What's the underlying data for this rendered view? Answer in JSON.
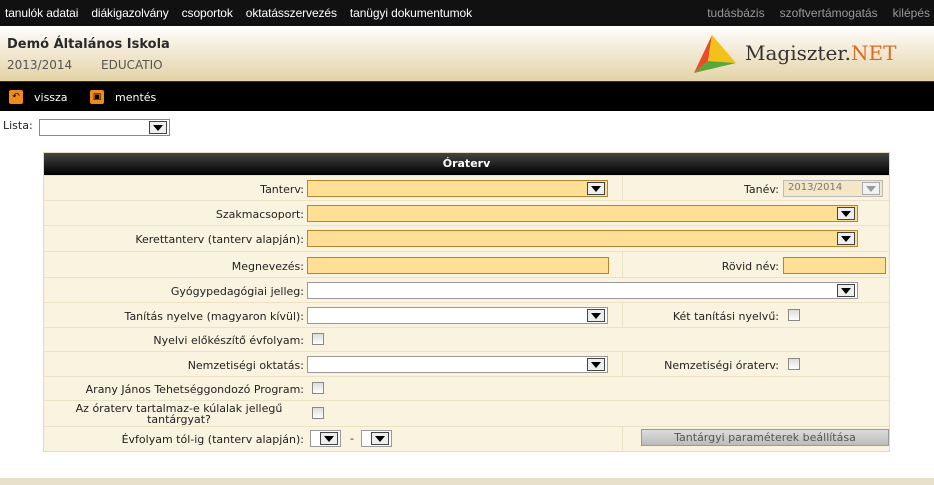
{
  "topnav": {
    "items": [
      "tanulók adatai",
      "diákigazolvány",
      "csoportok",
      "oktatásszervezés",
      "tanügyi dokumentumok"
    ],
    "right_items": [
      "tudásbázis",
      "szoftvertámogatás",
      "kilépés"
    ]
  },
  "header": {
    "school": "Demó Általános Iskola",
    "year": "2013/2014",
    "edu": "EDUCATIO",
    "logo_main": "Magiszter.",
    "logo_net": "NET"
  },
  "toolbar": {
    "back_label": "vissza",
    "save_label": "mentés"
  },
  "lista": {
    "label": "Lista:",
    "value": ""
  },
  "panel": {
    "title": "Óraterv",
    "tanterv_label": "Tanterv:",
    "tanev_label": "Tanév:",
    "tanev_value": "2013/2014",
    "szakmacsoport_label": "Szakmacsoport:",
    "kerettanterv_label": "Kerettanterv (tanterv alapján):",
    "megnevezes_label": "Megnevezés:",
    "rovidnev_label": "Rövid név:",
    "gyogyped_label": "Gyógypedagógiai jelleg:",
    "tanitas_nyelve_label": "Tanítás nyelve (magyaron kívül):",
    "ket_tanitasi_label": "Két tanítási nyelvű:",
    "nyelvi_elokeszito_label": "Nyelvi előkészítő évfolyam:",
    "nemzetisegi_oktatas_label": "Nemzetiségi oktatás:",
    "nemzetisegi_oraterv_label": "Nemzetiségi óraterv:",
    "arany_janos_label": "Arany János Tehetséggondozó Program:",
    "kulalak_label_1": "Az óraterv tartalmaz-e kúlalak jellegű",
    "kulalak_label_2": "tantárgyat?",
    "evfolyam_label": "Évfolyam tól-ig (tanterv alapján):",
    "dash": "-",
    "param_button": "Tantárgyi paraméterek beállítása"
  },
  "colors": {
    "accent": "#f08a1a",
    "field": "#fddf96",
    "panel": "#faf3df"
  }
}
